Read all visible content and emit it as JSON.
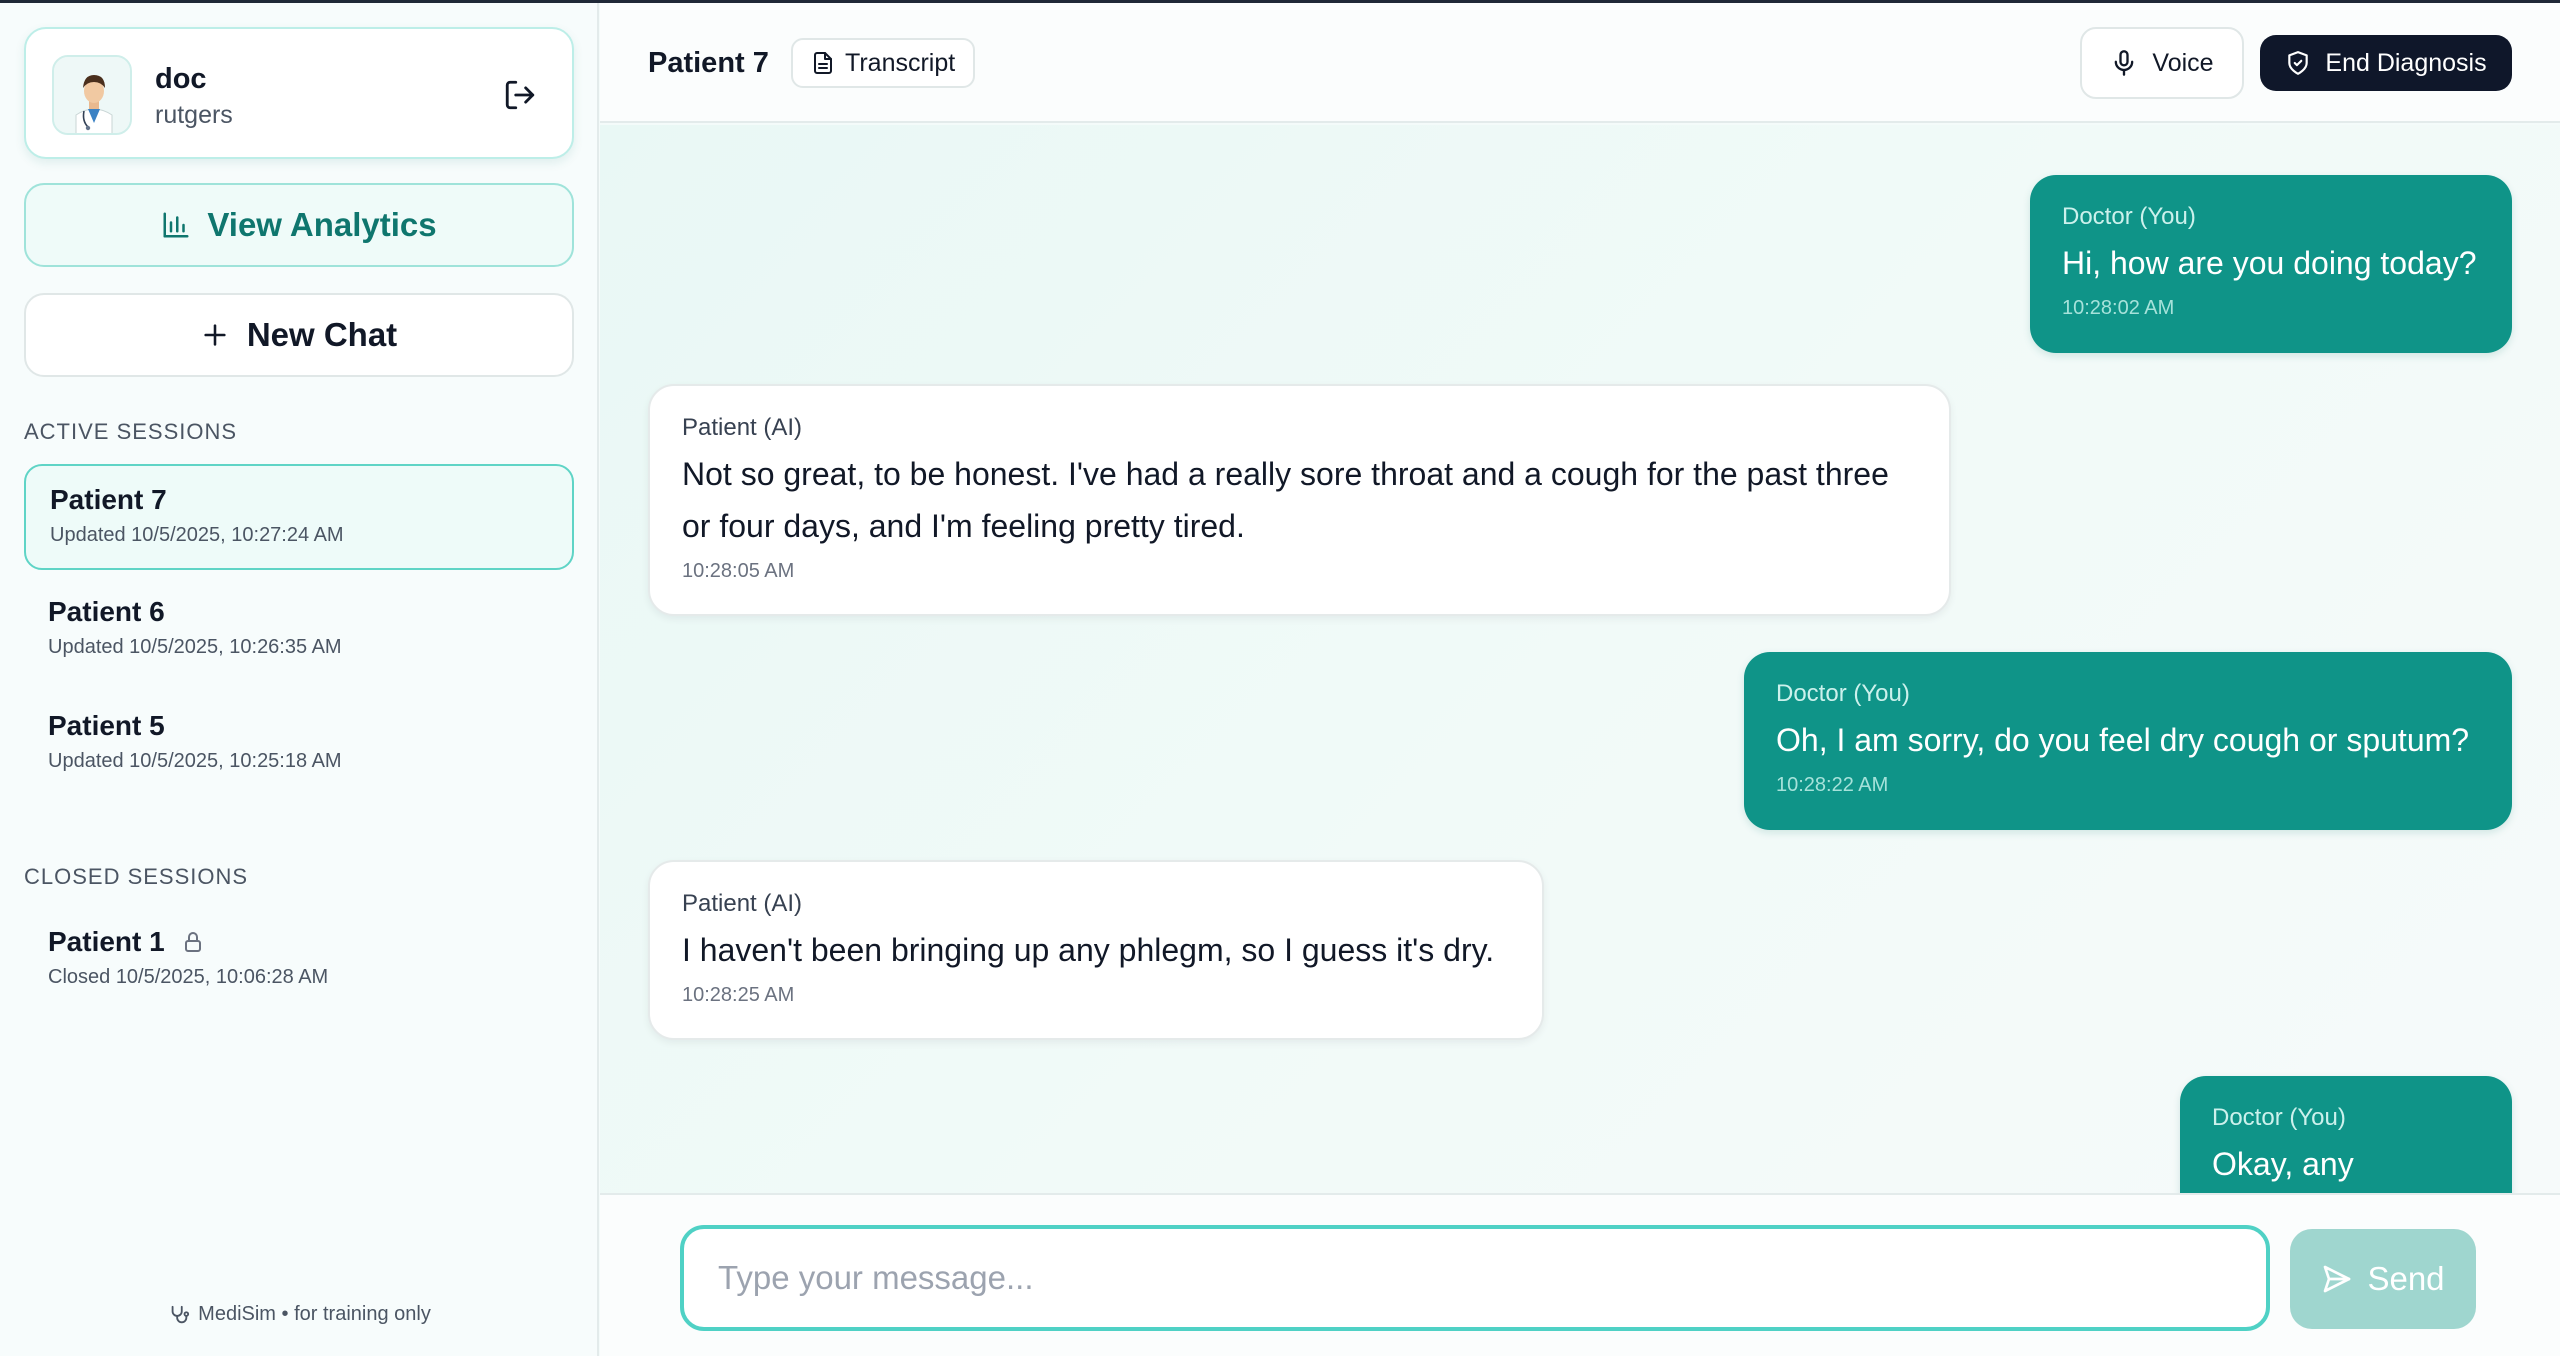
{
  "user": {
    "name": "doc",
    "org": "rutgers"
  },
  "sidebar": {
    "analytics_label": "View Analytics",
    "new_chat_label": "New Chat",
    "active_heading": "ACTIVE SESSIONS",
    "closed_heading": "CLOSED SESSIONS",
    "active_sessions": [
      {
        "title": "Patient 7",
        "subtitle": "Updated 10/5/2025, 10:27:24 AM"
      },
      {
        "title": "Patient 6",
        "subtitle": "Updated 10/5/2025, 10:26:35 AM"
      },
      {
        "title": "Patient 5",
        "subtitle": "Updated 10/5/2025, 10:25:18 AM"
      }
    ],
    "closed_sessions": [
      {
        "title": "Patient 1",
        "subtitle": "Closed 10/5/2025, 10:06:28 AM"
      }
    ],
    "footer": "MediSim • for training only"
  },
  "header": {
    "title": "Patient 7",
    "transcript_label": "Transcript",
    "voice_label": "Voice",
    "end_label": "End Diagnosis"
  },
  "messages": [
    {
      "sender": "Doctor (You)",
      "text": "Hi, how are you doing today?",
      "time": "10:28:02 AM"
    },
    {
      "sender": "Patient (AI)",
      "text": "Not so great, to be honest. I've had a really sore throat and a cough for the past three or four days, and I'm feeling pretty tired.",
      "time": "10:28:05 AM"
    },
    {
      "sender": "Doctor (You)",
      "text": "Oh, I am sorry, do you feel dry cough or sputum?",
      "time": "10:28:22 AM"
    },
    {
      "sender": "Patient (AI)",
      "text": "I haven't been bringing up any phlegm, so I guess it's dry.",
      "time": "10:28:25 AM"
    },
    {
      "sender": "Doctor (You)",
      "text": "Okay, any nausea?",
      "time": ""
    }
  ],
  "composer": {
    "placeholder": "Type your message...",
    "value": "",
    "send_label": "Send"
  },
  "colors": {
    "accent": "#0f9488",
    "dark": "#0f172a",
    "input_border": "#4fd1c5"
  }
}
